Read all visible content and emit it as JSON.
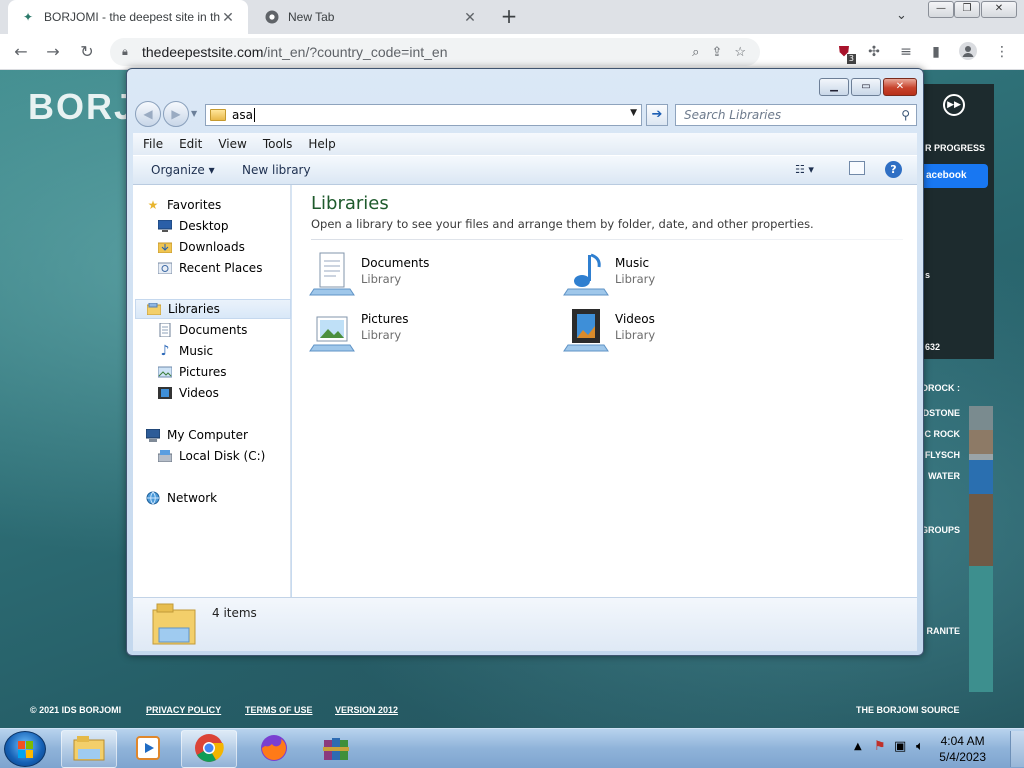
{
  "browser": {
    "tabs": [
      {
        "title": "BORJOMI - the deepest site in th",
        "favicon": "borjomi-favicon"
      },
      {
        "title": "New Tab",
        "favicon": "chrome-favicon"
      }
    ],
    "url_host": "thedeepestsite.com",
    "url_path": "/int_en/?country_code=int_en",
    "extension_badge": "3"
  },
  "website": {
    "brand": "BORJ",
    "side_panel": {
      "progress_label": "R PROGRESS",
      "facebook_label": "acebook",
      "row3": "s",
      "row4": "632"
    },
    "layers": [
      "DROCK :",
      "DSTONE",
      "C ROCK",
      "FLYSCH",
      "WATER",
      "GROUPS",
      "RANITE"
    ],
    "footer": {
      "copyright": "© 2021 IDS BORJOMI",
      "privacy": "PRIVACY POLICY",
      "terms": "TERMS OF USE",
      "version": "VERSION 2012",
      "source": "THE BORJOMI SOURCE"
    }
  },
  "explorer": {
    "address_value": "asa",
    "search_placeholder": "Search Libraries",
    "menu": [
      "File",
      "Edit",
      "View",
      "Tools",
      "Help"
    ],
    "commands": {
      "organize": "Organize",
      "new_library": "New library"
    },
    "nav": {
      "favorites": "Favorites",
      "desktop": "Desktop",
      "downloads": "Downloads",
      "recent": "Recent Places",
      "libraries": "Libraries",
      "documents": "Documents",
      "music": "Music",
      "pictures": "Pictures",
      "videos": "Videos",
      "computer": "My Computer",
      "local_disk": "Local Disk (C:)",
      "network": "Network"
    },
    "header": {
      "title": "Libraries",
      "subtitle": "Open a library to see your files and arrange them by folder, date, and other properties."
    },
    "libraries": [
      {
        "name": "Documents",
        "type": "Library",
        "icon": "documents-library-icon"
      },
      {
        "name": "Music",
        "type": "Library",
        "icon": "music-library-icon"
      },
      {
        "name": "Pictures",
        "type": "Library",
        "icon": "pictures-library-icon"
      },
      {
        "name": "Videos",
        "type": "Library",
        "icon": "videos-library-icon"
      }
    ],
    "details": {
      "count": "4 items"
    }
  },
  "taskbar": {
    "time": "4:04 AM",
    "date": "5/4/2023"
  },
  "colors": {
    "explorer_title_green": "#1e5a2c",
    "taskbar_blue": "#8fb3d9",
    "page_teal": "#2f7178"
  }
}
